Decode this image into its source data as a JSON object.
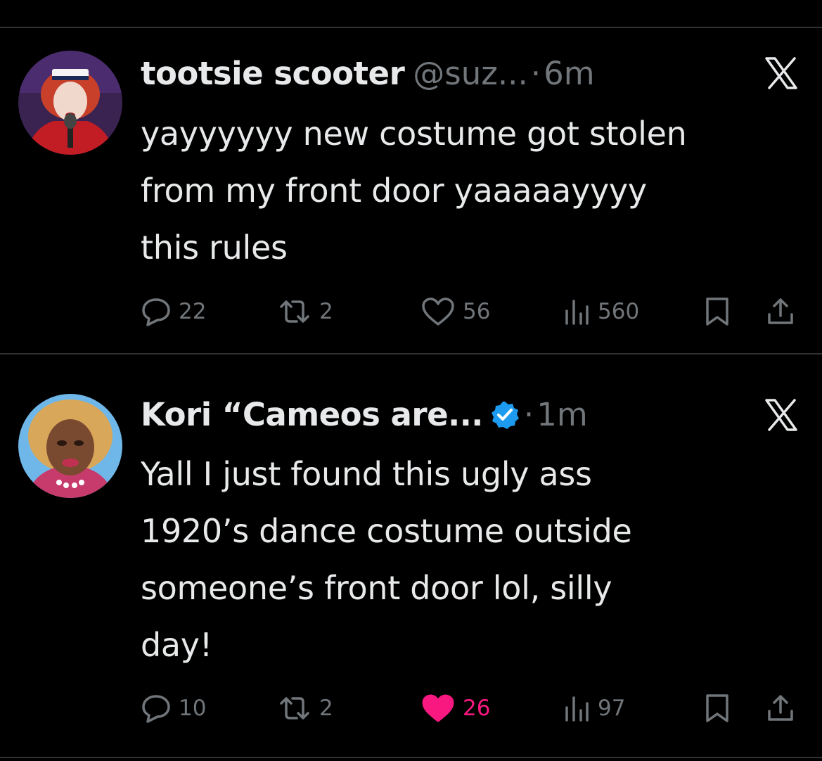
{
  "tweets": [
    {
      "author_name": "tootsie scooter",
      "handle": "@suz...",
      "separator": "·",
      "time": "6m",
      "verified": false,
      "body_lines": [
        "yayyyyyy new costume got stolen",
        "from my front door yaaaaayyyy",
        "this rules"
      ],
      "replies": "22",
      "reposts": "2",
      "likes": "56",
      "views": "560",
      "liked": false
    },
    {
      "author_name": "Kori “Cameos are...",
      "handle": "",
      "separator": "·",
      "time": "1m",
      "verified": true,
      "body_lines": [
        "Yall I just found this ugly ass",
        "1920’s dance costume outside",
        "someone’s front door lol, silly",
        "day!"
      ],
      "replies": "10",
      "reposts": "2",
      "likes": "26",
      "views": "97",
      "liked": true
    }
  ],
  "icons": {
    "reply": "speech-bubble",
    "repost": "two-arrows-loop",
    "like": "heart",
    "views": "bar-chart",
    "bookmark": "bookmark",
    "share": "share-up-arrow",
    "close": "x-mark",
    "verified": "blue-badge-check"
  },
  "colors": {
    "background": "#000000",
    "text": "#e7e9ea",
    "secondary": "#71767b",
    "like_active": "#f91880",
    "verified": "#1d9bf0",
    "divider": "#2f3336"
  }
}
